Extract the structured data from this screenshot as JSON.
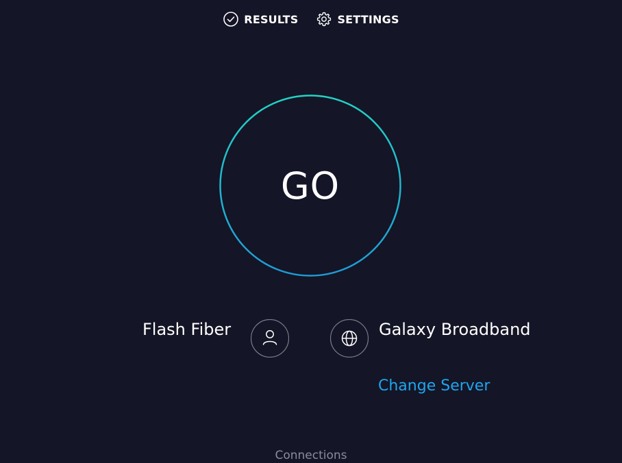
{
  "nav": {
    "results_label": "RESULTS",
    "settings_label": "SETTINGS"
  },
  "go_button": {
    "label": "GO"
  },
  "isp": {
    "name": "Flash Fiber",
    "icon": "user-icon"
  },
  "server": {
    "name": "Galaxy Broadband",
    "icon": "globe-icon",
    "change_label": "Change Server"
  },
  "footer": {
    "connections_label": "Connections"
  },
  "colors": {
    "background": "#141526",
    "ring_top": "#22d3c5",
    "ring_bottom": "#1e9ad6",
    "link": "#1ea5f0",
    "muted": "#8a8c9c",
    "icon_ring": "#7b7d8c"
  }
}
